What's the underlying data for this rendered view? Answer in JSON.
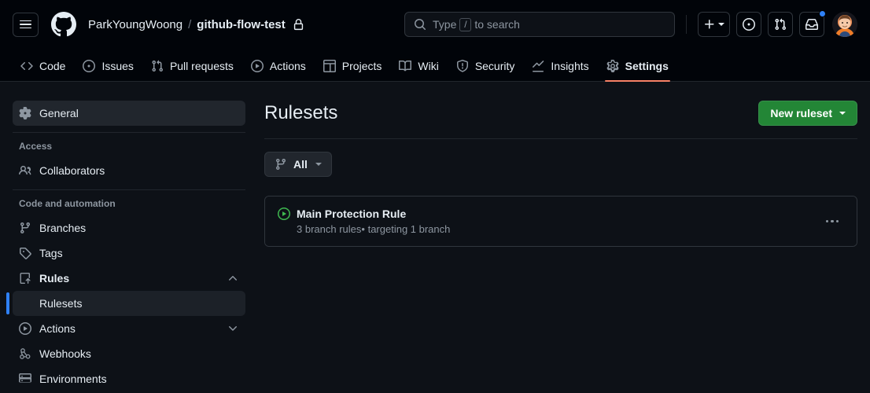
{
  "header": {
    "menu_icon": "hamburger-menu-icon",
    "logo_icon": "github-logo-icon",
    "owner": "ParkYoungWoong",
    "separator": "/",
    "repo": "github-flow-test",
    "visibility_icon": "lock-icon",
    "search": {
      "placeholder_prefix": "Type",
      "key_hint": "/",
      "placeholder_suffix": "to search"
    },
    "actions": [
      {
        "name": "create-new-menu",
        "icon": "plus-icon",
        "has_caret": true
      },
      {
        "name": "issues-button",
        "icon": "issue-opened-icon",
        "has_caret": false
      },
      {
        "name": "pull-requests-button",
        "icon": "git-pull-request-icon",
        "has_caret": false
      },
      {
        "name": "notifications-button",
        "icon": "inbox-icon",
        "has_caret": false,
        "unread": true
      }
    ],
    "avatar_alt": "user-avatar"
  },
  "repo_nav": {
    "tabs": [
      {
        "label": "Code",
        "icon": "code-icon",
        "active": false
      },
      {
        "label": "Issues",
        "icon": "issue-opened-icon",
        "active": false
      },
      {
        "label": "Pull requests",
        "icon": "git-pull-request-icon",
        "active": false
      },
      {
        "label": "Actions",
        "icon": "play-icon",
        "active": false
      },
      {
        "label": "Projects",
        "icon": "table-icon",
        "active": false
      },
      {
        "label": "Wiki",
        "icon": "book-icon",
        "active": false
      },
      {
        "label": "Security",
        "icon": "shield-icon",
        "active": false
      },
      {
        "label": "Insights",
        "icon": "graph-icon",
        "active": false
      },
      {
        "label": "Settings",
        "icon": "gear-icon",
        "active": true
      }
    ],
    "active_indicator_color": "#f78166"
  },
  "sidebar": {
    "general": {
      "label": "General",
      "icon": "gear-icon"
    },
    "sections": [
      {
        "heading": "Access",
        "items": [
          {
            "label": "Collaborators",
            "icon": "people-icon"
          }
        ]
      },
      {
        "heading": "Code and automation",
        "items": [
          {
            "label": "Branches",
            "icon": "git-branch-icon"
          },
          {
            "label": "Tags",
            "icon": "tag-icon"
          },
          {
            "label": "Rules",
            "icon": "rules-icon",
            "expanded": true,
            "chevron": "chevron-up-icon",
            "bold": true
          },
          {
            "label": "Rulesets",
            "sub": true,
            "current": true
          },
          {
            "label": "Actions",
            "icon": "play-icon",
            "expanded": false,
            "chevron": "chevron-down-icon"
          },
          {
            "label": "Webhooks",
            "icon": "webhook-icon"
          },
          {
            "label": "Environments",
            "icon": "server-icon"
          }
        ]
      }
    ],
    "active_bar_color": "#2f81f7"
  },
  "main": {
    "title": "Rulesets",
    "new_ruleset_button": {
      "label": "New ruleset",
      "color": "#238636",
      "has_caret": true
    },
    "filter": {
      "label": "All",
      "icon": "git-branch-icon",
      "has_caret": true
    },
    "rulesets": [
      {
        "name": "Main Protection Rule",
        "status_icon": "active-play-circle-icon",
        "status_color": "#3fb950",
        "rules_count_text": "3 branch rules",
        "separator": "•",
        "targets_text": "targeting 1 branch",
        "menu_icon": "kebab-horizontal-icon"
      }
    ]
  }
}
